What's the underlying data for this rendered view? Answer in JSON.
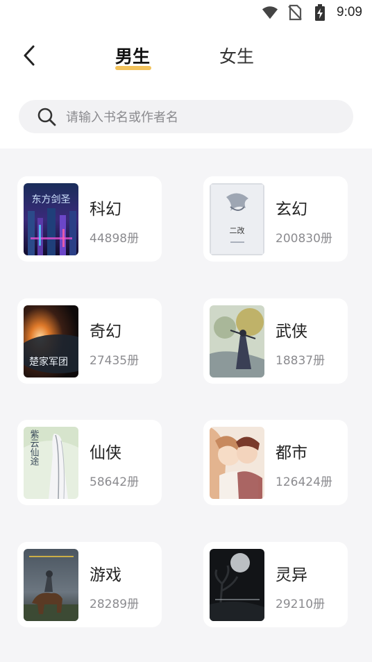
{
  "status_bar": {
    "time": "9:09"
  },
  "header": {
    "tabs": [
      {
        "label": "男生",
        "active": true
      },
      {
        "label": "女生",
        "active": false
      }
    ]
  },
  "search": {
    "placeholder": "请输入书名或作者名"
  },
  "categories": [
    {
      "name": "科幻",
      "count": "44898册",
      "cover_title": "东方剑圣"
    },
    {
      "name": "玄幻",
      "count": "200830册",
      "cover_title": "二改"
    },
    {
      "name": "奇幻",
      "count": "27435册",
      "cover_title": "楚家军团"
    },
    {
      "name": "武侠",
      "count": "18837册",
      "cover_title": ""
    },
    {
      "name": "仙侠",
      "count": "58642册",
      "cover_title": "紫云仙途"
    },
    {
      "name": "都市",
      "count": "126424册",
      "cover_title": ""
    },
    {
      "name": "游戏",
      "count": "28289册",
      "cover_title": ""
    },
    {
      "name": "灵异",
      "count": "29210册",
      "cover_title": ""
    }
  ],
  "colors": {
    "accent_underline": "#f2c25b",
    "page_bg": "#f5f5f7",
    "card_bg": "#ffffff"
  }
}
